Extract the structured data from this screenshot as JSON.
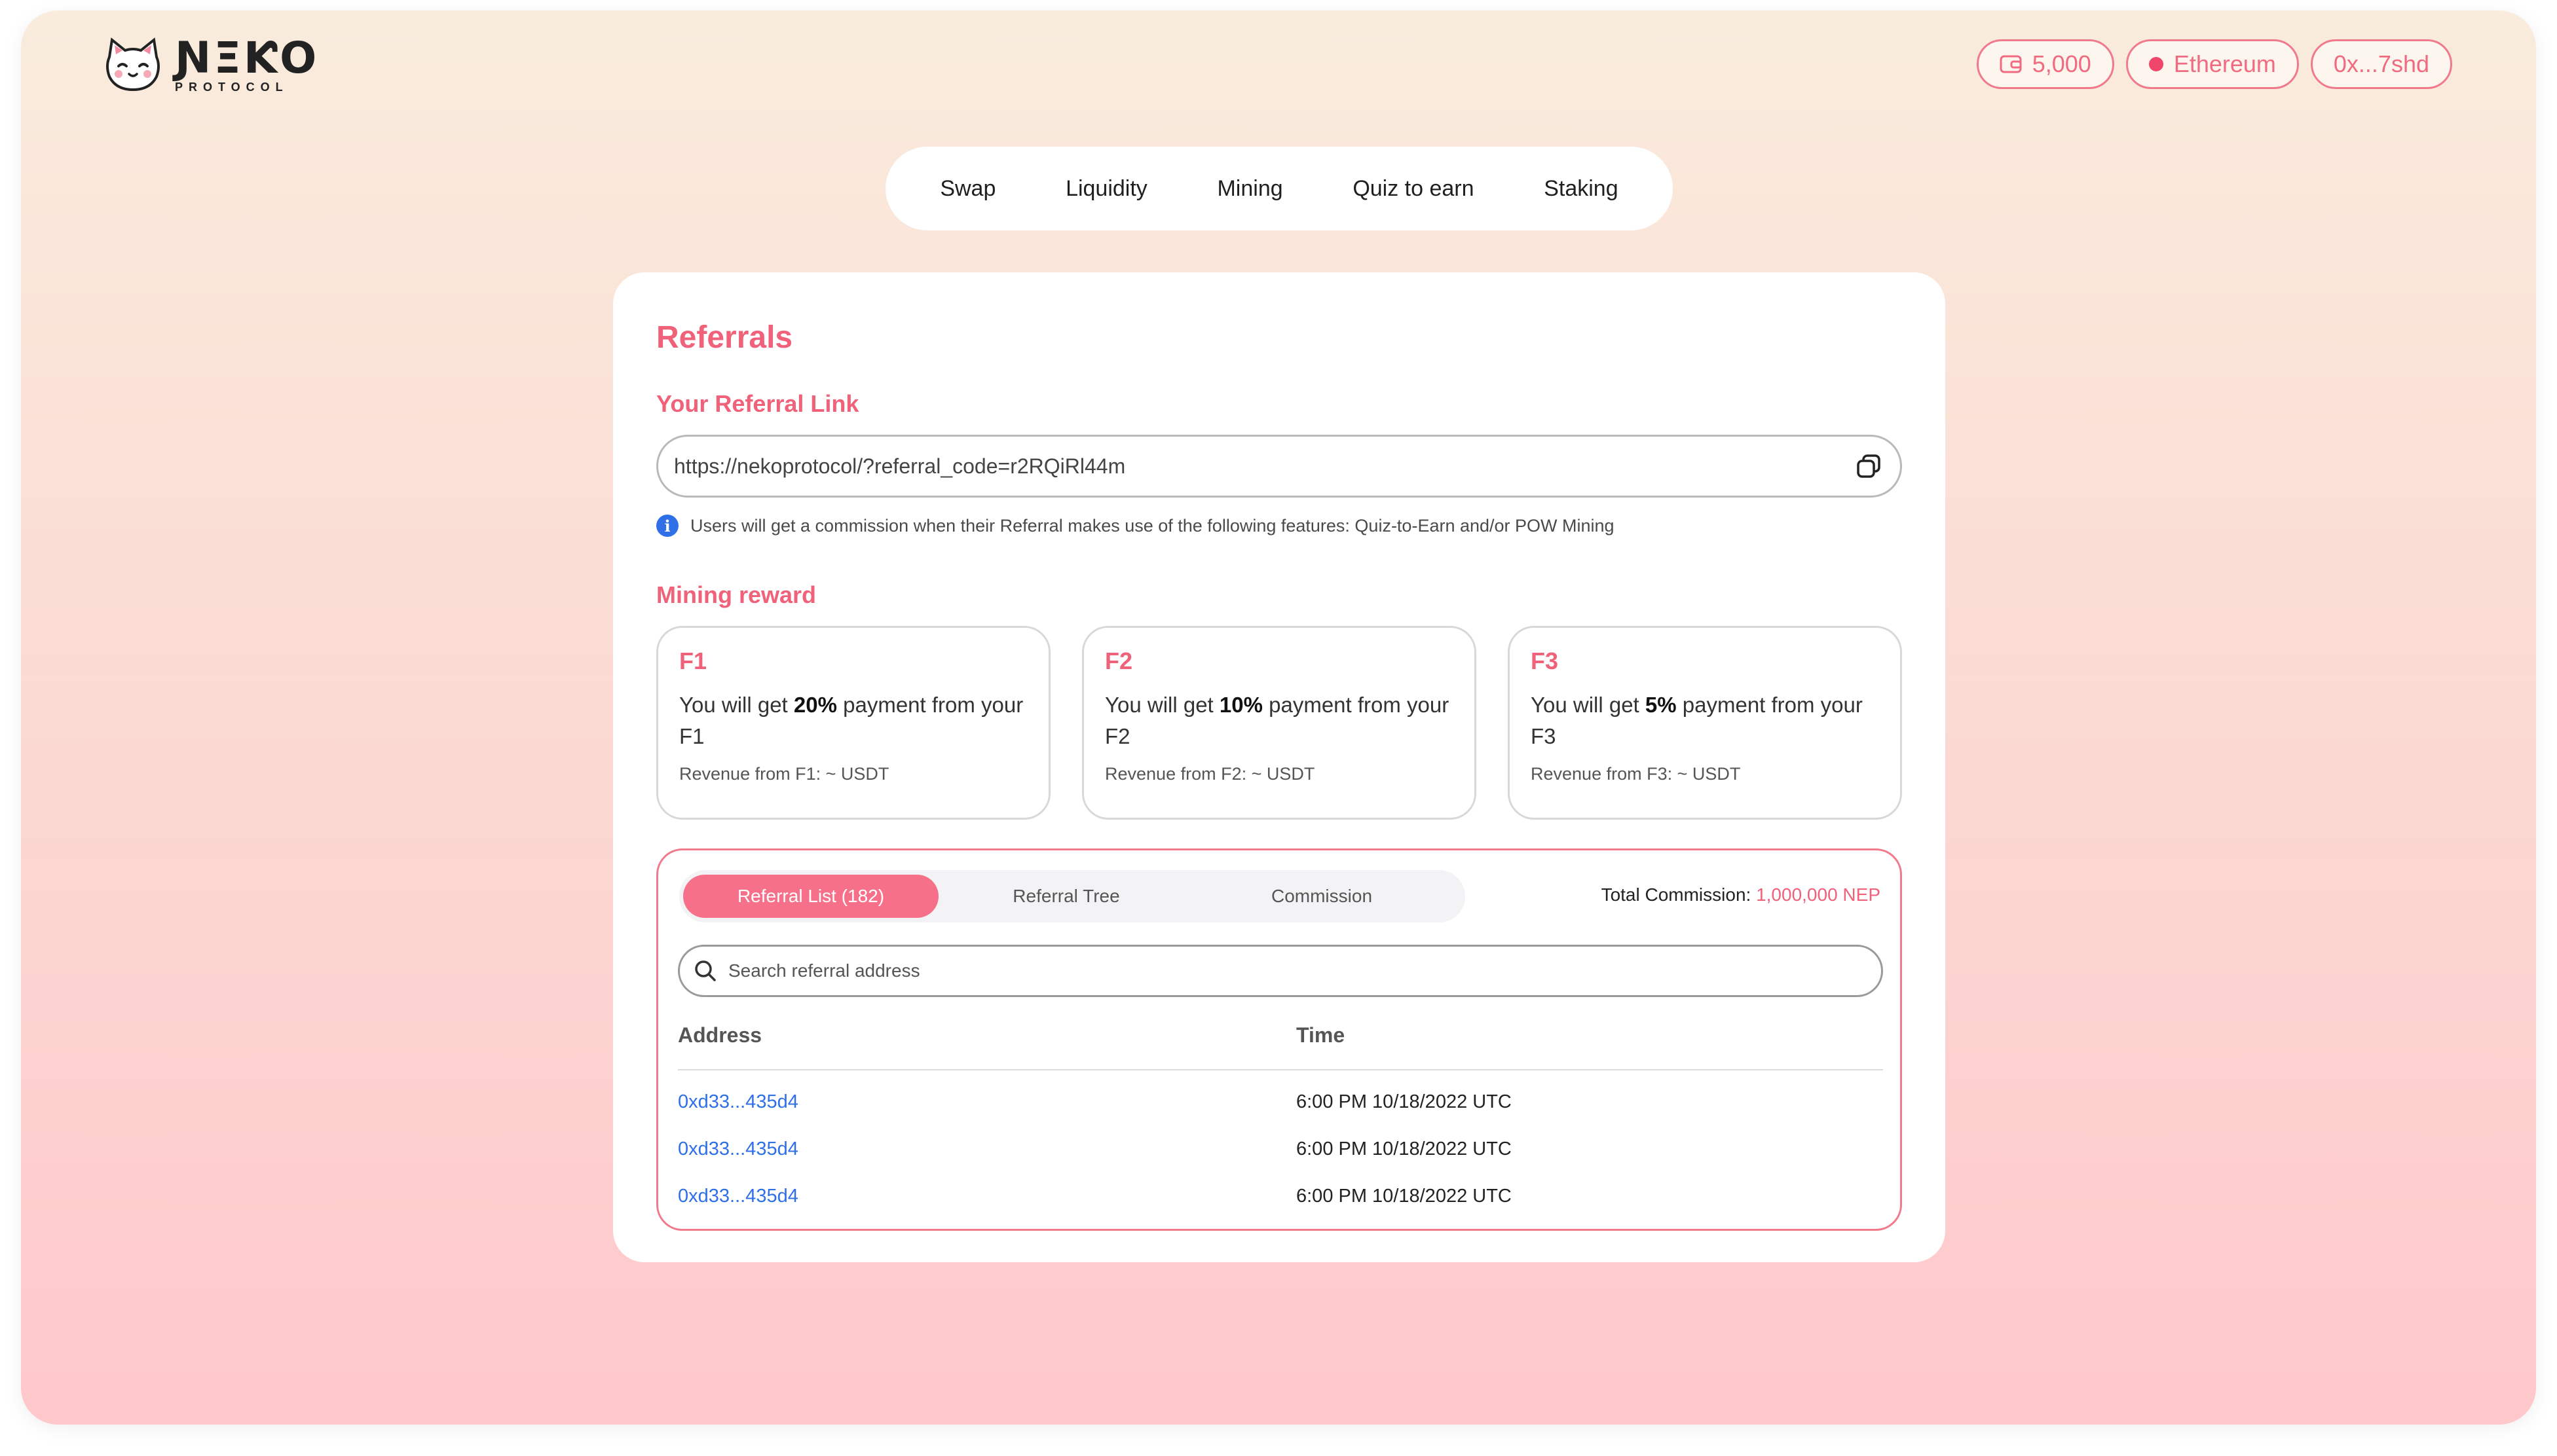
{
  "header": {
    "logo_word": "ƝΞƘO",
    "logo_sub": "PROTOCOL",
    "balance": "5,000",
    "network": "Ethereum",
    "account": "0x...7shd"
  },
  "nav": {
    "items": [
      "Swap",
      "Liquidity",
      "Mining",
      "Quiz to earn",
      "Staking"
    ]
  },
  "referrals": {
    "title": "Referrals",
    "link_label": "Your Referral Link",
    "link_value": "https://nekoprotocol/?referral_code=r2RQiRl44m",
    "info_text": "Users will get a commission when their Referral makes use of the following features: Quiz-to-Earn and/or POW Mining"
  },
  "mining": {
    "title": "Mining reward",
    "tiers": [
      {
        "name": "F1",
        "pre": "You will get ",
        "pct": "20%",
        "post": " payment from your F1",
        "revenue": "Revenue from F1: ~ USDT"
      },
      {
        "name": "F2",
        "pre": "You will get ",
        "pct": "10%",
        "post": " payment from your F2",
        "revenue": "Revenue from F2: ~ USDT"
      },
      {
        "name": "F3",
        "pre": "You will get ",
        "pct": "5%",
        "post": " payment from your F3",
        "revenue": "Revenue from F3: ~ USDT"
      }
    ]
  },
  "panel": {
    "tabs": [
      "Referral List (182)",
      "Referral Tree",
      "Commission"
    ],
    "active_tab": 0,
    "total_label": "Total Commission: ",
    "total_value": "1,000,000 NEP",
    "search_placeholder": "Search referral address",
    "columns": [
      "Address",
      "Time"
    ],
    "rows": [
      {
        "address": "0xd33...435d4",
        "time": "6:00 PM 10/18/2022 UTC"
      },
      {
        "address": "0xd33...435d4",
        "time": "6:00 PM 10/18/2022 UTC"
      },
      {
        "address": "0xd33...435d4",
        "time": "6:00 PM 10/18/2022 UTC"
      }
    ]
  },
  "colors": {
    "accent": "#f0617a",
    "link": "#2f6fe8"
  }
}
